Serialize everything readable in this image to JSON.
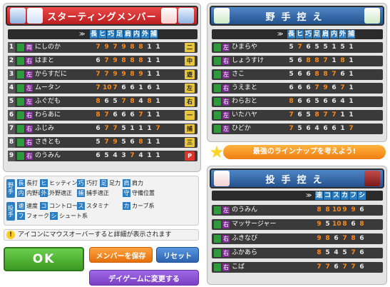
{
  "starting": {
    "title": "スターティングメンバー",
    "stat_headers": [
      "長",
      "ヒ",
      "巧",
      "足",
      "肩",
      "内",
      "外",
      "捕"
    ],
    "rows": [
      {
        "num": "1",
        "hand": "両",
        "name": "にしのか",
        "stats": [
          "7",
          "9",
          "7",
          "9",
          "8",
          "8",
          "1",
          "1"
        ],
        "pos": "二"
      },
      {
        "num": "2",
        "hand": "右",
        "name": "はまと",
        "stats": [
          "6",
          "7",
          "9",
          "8",
          "8",
          "8",
          "1",
          "1"
        ],
        "pos": "中"
      },
      {
        "num": "3",
        "hand": "左",
        "name": "からすだに",
        "stats": [
          "7",
          "7",
          "9",
          "9",
          "8",
          "9",
          "1",
          "1"
        ],
        "pos": "遊"
      },
      {
        "num": "4",
        "hand": "左",
        "name": "ムータン",
        "stats": [
          "7",
          "10",
          "7",
          "6",
          "6",
          "1",
          "6",
          "1"
        ],
        "pos": "左"
      },
      {
        "num": "5",
        "hand": "左",
        "name": "ふぐだも",
        "stats": [
          "8",
          "6",
          "5",
          "7",
          "8",
          "4",
          "8",
          "1"
        ],
        "pos": "右"
      },
      {
        "num": "6",
        "hand": "右",
        "name": "わらあに",
        "stats": [
          "8",
          "7",
          "6",
          "6",
          "6",
          "7",
          "1",
          "1"
        ],
        "pos": "一"
      },
      {
        "num": "7",
        "hand": "右",
        "name": "ふじみ",
        "stats": [
          "6",
          "7",
          "7",
          "5",
          "1",
          "1",
          "1",
          "7"
        ],
        "pos": "捕"
      },
      {
        "num": "8",
        "hand": "右",
        "name": "さきとも",
        "stats": [
          "5",
          "7",
          "9",
          "5",
          "6",
          "8",
          "1",
          "1"
        ],
        "pos": "三"
      },
      {
        "num": "9",
        "hand": "右",
        "name": "のうみん",
        "stats": [
          "6",
          "5",
          "4",
          "3",
          "7",
          "4",
          "1",
          "1"
        ],
        "pos": "P"
      }
    ]
  },
  "bench": {
    "title": "野手控え",
    "stat_headers": [
      "長",
      "ヒ",
      "巧",
      "足",
      "肩",
      "内",
      "外",
      "捕"
    ],
    "rows": [
      {
        "hand": "左",
        "name": "ひまらや",
        "stats": [
          "5",
          "7",
          "6",
          "5",
          "5",
          "1",
          "5",
          "1"
        ]
      },
      {
        "hand": "右",
        "name": "しょうすけ",
        "stats": [
          "5",
          "6",
          "8",
          "8",
          "7",
          "1",
          "8",
          "1"
        ]
      },
      {
        "hand": "左",
        "name": "さこ",
        "stats": [
          "5",
          "6",
          "6",
          "8",
          "8",
          "7",
          "6",
          "1"
        ]
      },
      {
        "hand": "右",
        "name": "うえまと",
        "stats": [
          "6",
          "6",
          "6",
          "7",
          "9",
          "6",
          "7",
          "1"
        ]
      },
      {
        "hand": "右",
        "name": "わらおと",
        "stats": [
          "8",
          "6",
          "6",
          "5",
          "6",
          "6",
          "4",
          "1"
        ]
      },
      {
        "hand": "左",
        "name": "いたハヤ",
        "stats": [
          "7",
          "6",
          "5",
          "8",
          "7",
          "7",
          "1",
          "1"
        ]
      },
      {
        "hand": "左",
        "name": "ひどか",
        "stats": [
          "7",
          "5",
          "6",
          "4",
          "6",
          "6",
          "1",
          "7"
        ]
      }
    ]
  },
  "banner": "最強のラインナップを考えよう!",
  "pitchers": {
    "title": "投手控え",
    "stat_headers": [
      "速",
      "コ",
      "ス",
      "カ",
      "フ",
      "シ"
    ],
    "rows": [
      {
        "hand": "左",
        "name": "のうみん",
        "stats": [
          "8",
          "8",
          "10",
          "9",
          "9",
          "6"
        ]
      },
      {
        "hand": "右",
        "name": "マッサージャー",
        "stats": [
          "9",
          "5",
          "10",
          "8",
          "6",
          "8"
        ]
      },
      {
        "hand": "右",
        "name": "ふきなび",
        "stats": [
          "9",
          "8",
          "6",
          "7",
          "8",
          "6"
        ]
      },
      {
        "hand": "右",
        "name": "ふかあら",
        "stats": [
          "8",
          "5",
          "4",
          "5",
          "7",
          "6"
        ]
      },
      {
        "hand": "右",
        "name": "こば",
        "stats": [
          "7",
          "7",
          "6",
          "7",
          "7",
          "6"
        ]
      }
    ]
  },
  "legend": {
    "fielder_label": "野手",
    "pitcher_label": "投手",
    "fielder_items": [
      {
        "key": "長",
        "text": "長打"
      },
      {
        "key": "ヒ",
        "text": "ヒッティング"
      },
      {
        "key": "巧",
        "text": "巧打"
      },
      {
        "key": "足",
        "text": "足力"
      },
      {
        "key": "肩",
        "text": "肩力"
      },
      {
        "key": "内",
        "text": "内野適正"
      },
      {
        "key": "外",
        "text": "外野適正"
      },
      {
        "key": "捕",
        "text": "捕手適正"
      },
      {
        "key": "守",
        "text": "守備位置"
      }
    ],
    "pitcher_items": [
      {
        "key": "速",
        "text": "速度"
      },
      {
        "key": "コ",
        "text": "コントロール"
      },
      {
        "key": "ス",
        "text": "スタミナ"
      },
      {
        "key": "カ",
        "text": "カーブ系"
      },
      {
        "key": "フ",
        "text": "フォーク系"
      },
      {
        "key": "シ",
        "text": "シュート系"
      }
    ]
  },
  "hint": "アイコンにマウスオーバーすると詳細が表示されます",
  "buttons": {
    "ok": "OK",
    "save": "メンバーを保存",
    "reset": "リセット",
    "dayg": "デイゲームに変更する"
  },
  "colors": {
    "red_title": "#d43030",
    "blue_title": "#2f68a8",
    "stat_high": "#ff8a1a",
    "stat_low": "#e8e8e8",
    "ok_green": "#4cae36",
    "save_orange": "#f28a1a",
    "reset_blue": "#3b74c4",
    "dayg_purple": "#8a4fd0"
  }
}
